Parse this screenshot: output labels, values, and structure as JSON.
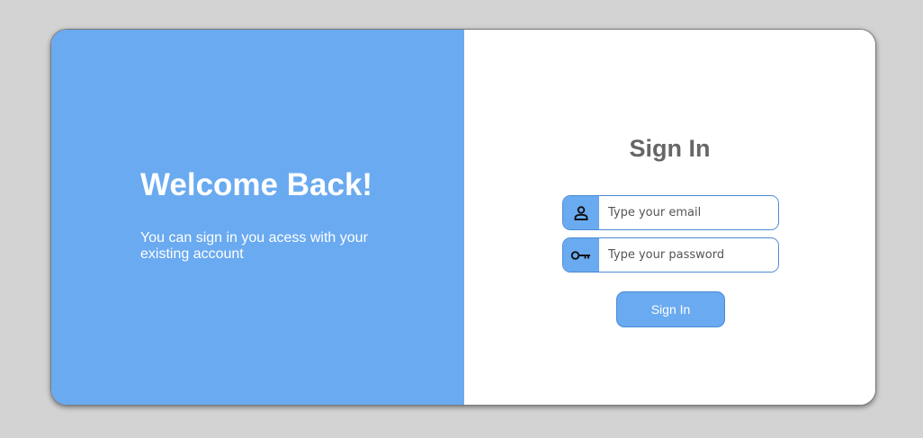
{
  "welcome": {
    "title": "Welcome Back!",
    "text": "You can sign in you acess with your existing account"
  },
  "signin": {
    "title": "Sign In",
    "email": {
      "placeholder": "Type your email",
      "value": "",
      "icon": "user-icon"
    },
    "password": {
      "placeholder": "Type your password",
      "value": "",
      "icon": "key-icon"
    },
    "submit_label": "Sign In"
  },
  "colors": {
    "accent": "#6aaaf0",
    "border": "#4a8ad6",
    "page_background": "#d3d3d3",
    "title": "#666666"
  }
}
